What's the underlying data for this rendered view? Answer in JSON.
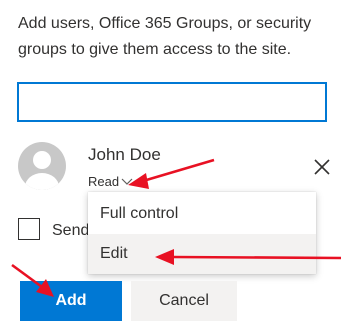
{
  "intro_text": "Add users, Office 365 Groups, or security groups to give them access to the site.",
  "search": {
    "value": ""
  },
  "user": {
    "name": "John Doe",
    "permission": "Read",
    "avatar_icon": "person-icon",
    "remove_icon": "close-icon"
  },
  "permission_menu": {
    "items": [
      {
        "label": "Full control",
        "highlighted": false
      },
      {
        "label": "Edit",
        "highlighted": true
      }
    ]
  },
  "send_email": {
    "label": "Send",
    "checked": false
  },
  "buttons": {
    "add_label": "Add",
    "cancel_label": "Cancel"
  },
  "annotations": {
    "arrow_color": "#e81123"
  },
  "colors": {
    "accent": "#0078d4",
    "neutral_button": "#f3f2f1",
    "text": "#323130"
  }
}
